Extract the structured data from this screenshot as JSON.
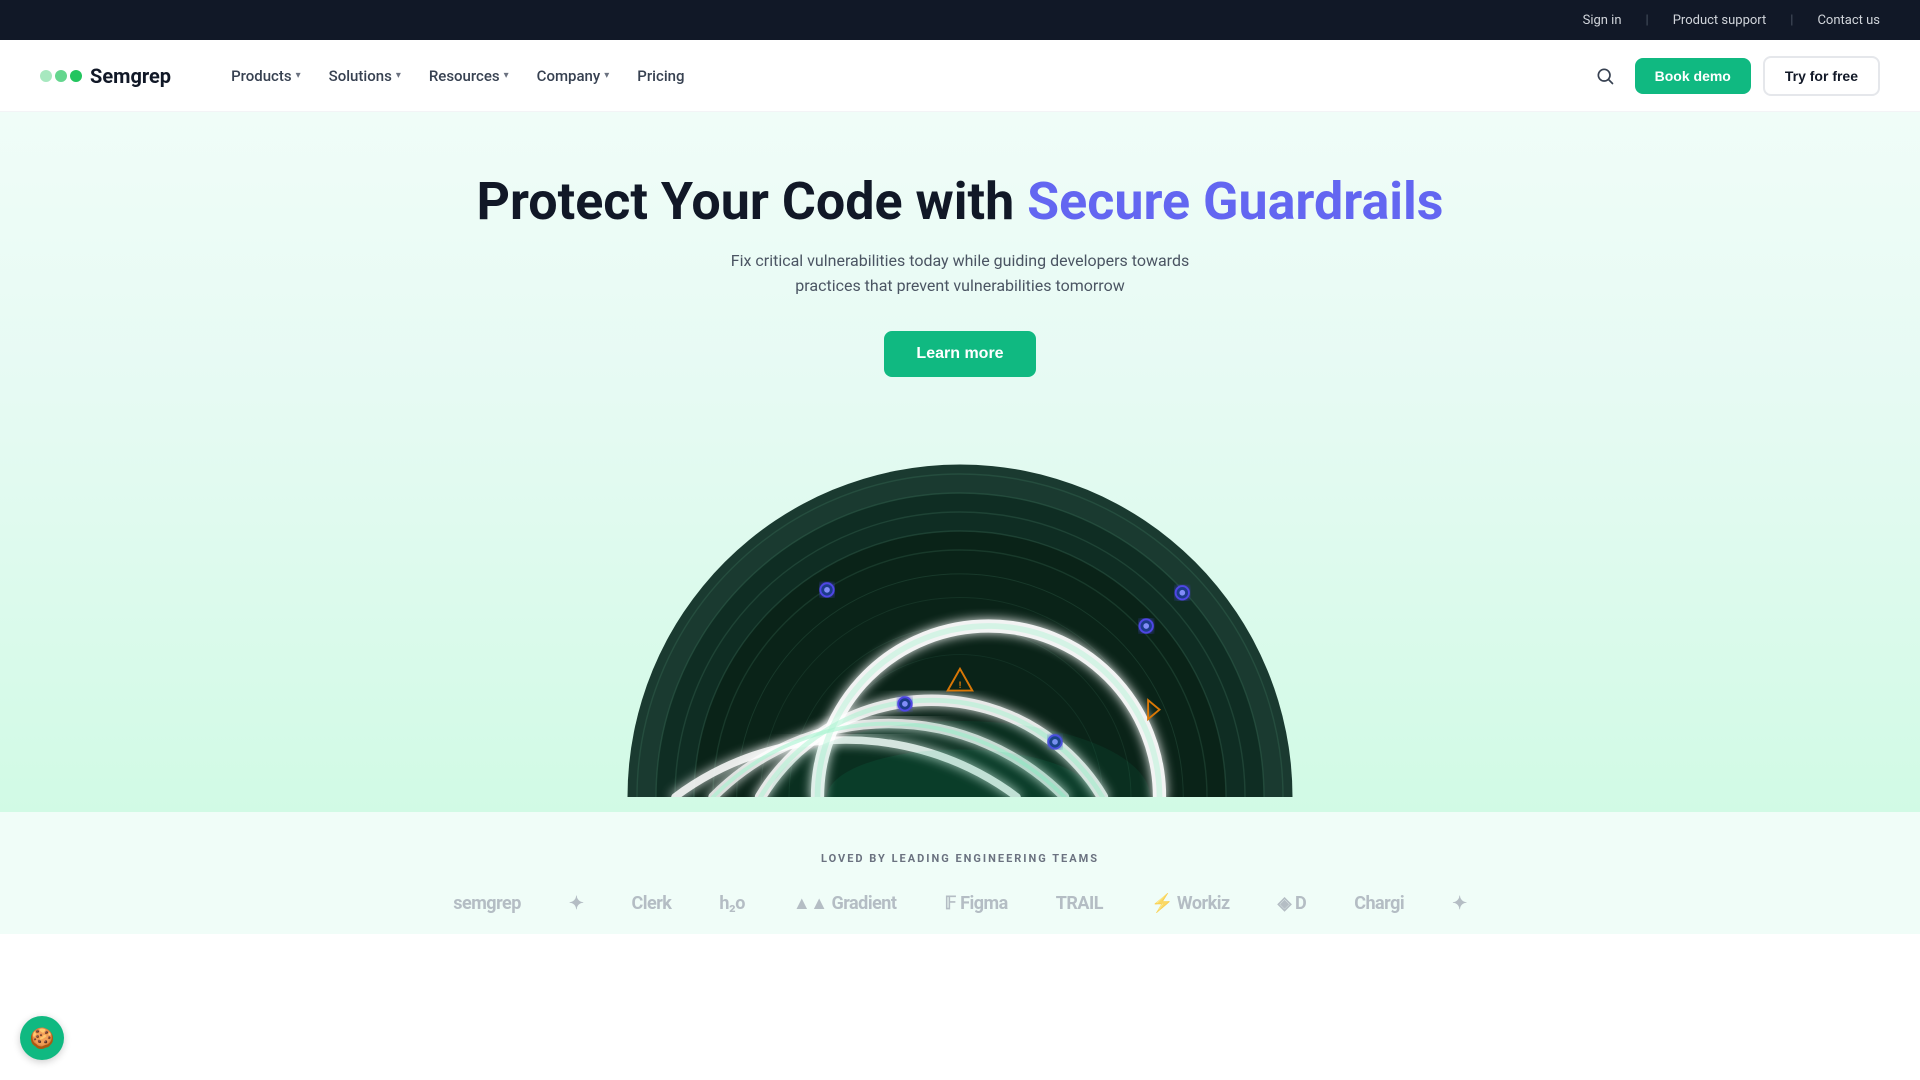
{
  "topbar": {
    "sign_in": "Sign in",
    "product_support": "Product support",
    "contact_us": "Contact us"
  },
  "navbar": {
    "logo_text": "Semgrep",
    "nav_items": [
      {
        "label": "Products",
        "has_dropdown": true
      },
      {
        "label": "Solutions",
        "has_dropdown": true
      },
      {
        "label": "Resources",
        "has_dropdown": true
      },
      {
        "label": "Company",
        "has_dropdown": true
      },
      {
        "label": "Pricing",
        "has_dropdown": false
      }
    ],
    "book_demo": "Book demo",
    "try_for_free": "Try for free"
  },
  "hero": {
    "title_before": "Protect Your Code with ",
    "title_accent": "Secure Guardrails",
    "subtitle": "Fix critical vulnerabilities today while guiding developers towards practices that prevent vulnerabilities tomorrow",
    "cta_label": "Learn more"
  },
  "loved": {
    "label": "LOVED BY LEADING ENGINEERING TEAMS",
    "brands": [
      "semgrep",
      "★",
      "Clerk",
      "h2o",
      "Gradient",
      "Figma",
      "TRAIL",
      "Workiz",
      "D",
      "Chargi",
      "★"
    ]
  },
  "colors": {
    "green_accent": "#10b981",
    "indigo_accent": "#6366f1",
    "hero_bg_start": "#f0fdf8",
    "hero_bg_end": "#d1fae5"
  }
}
